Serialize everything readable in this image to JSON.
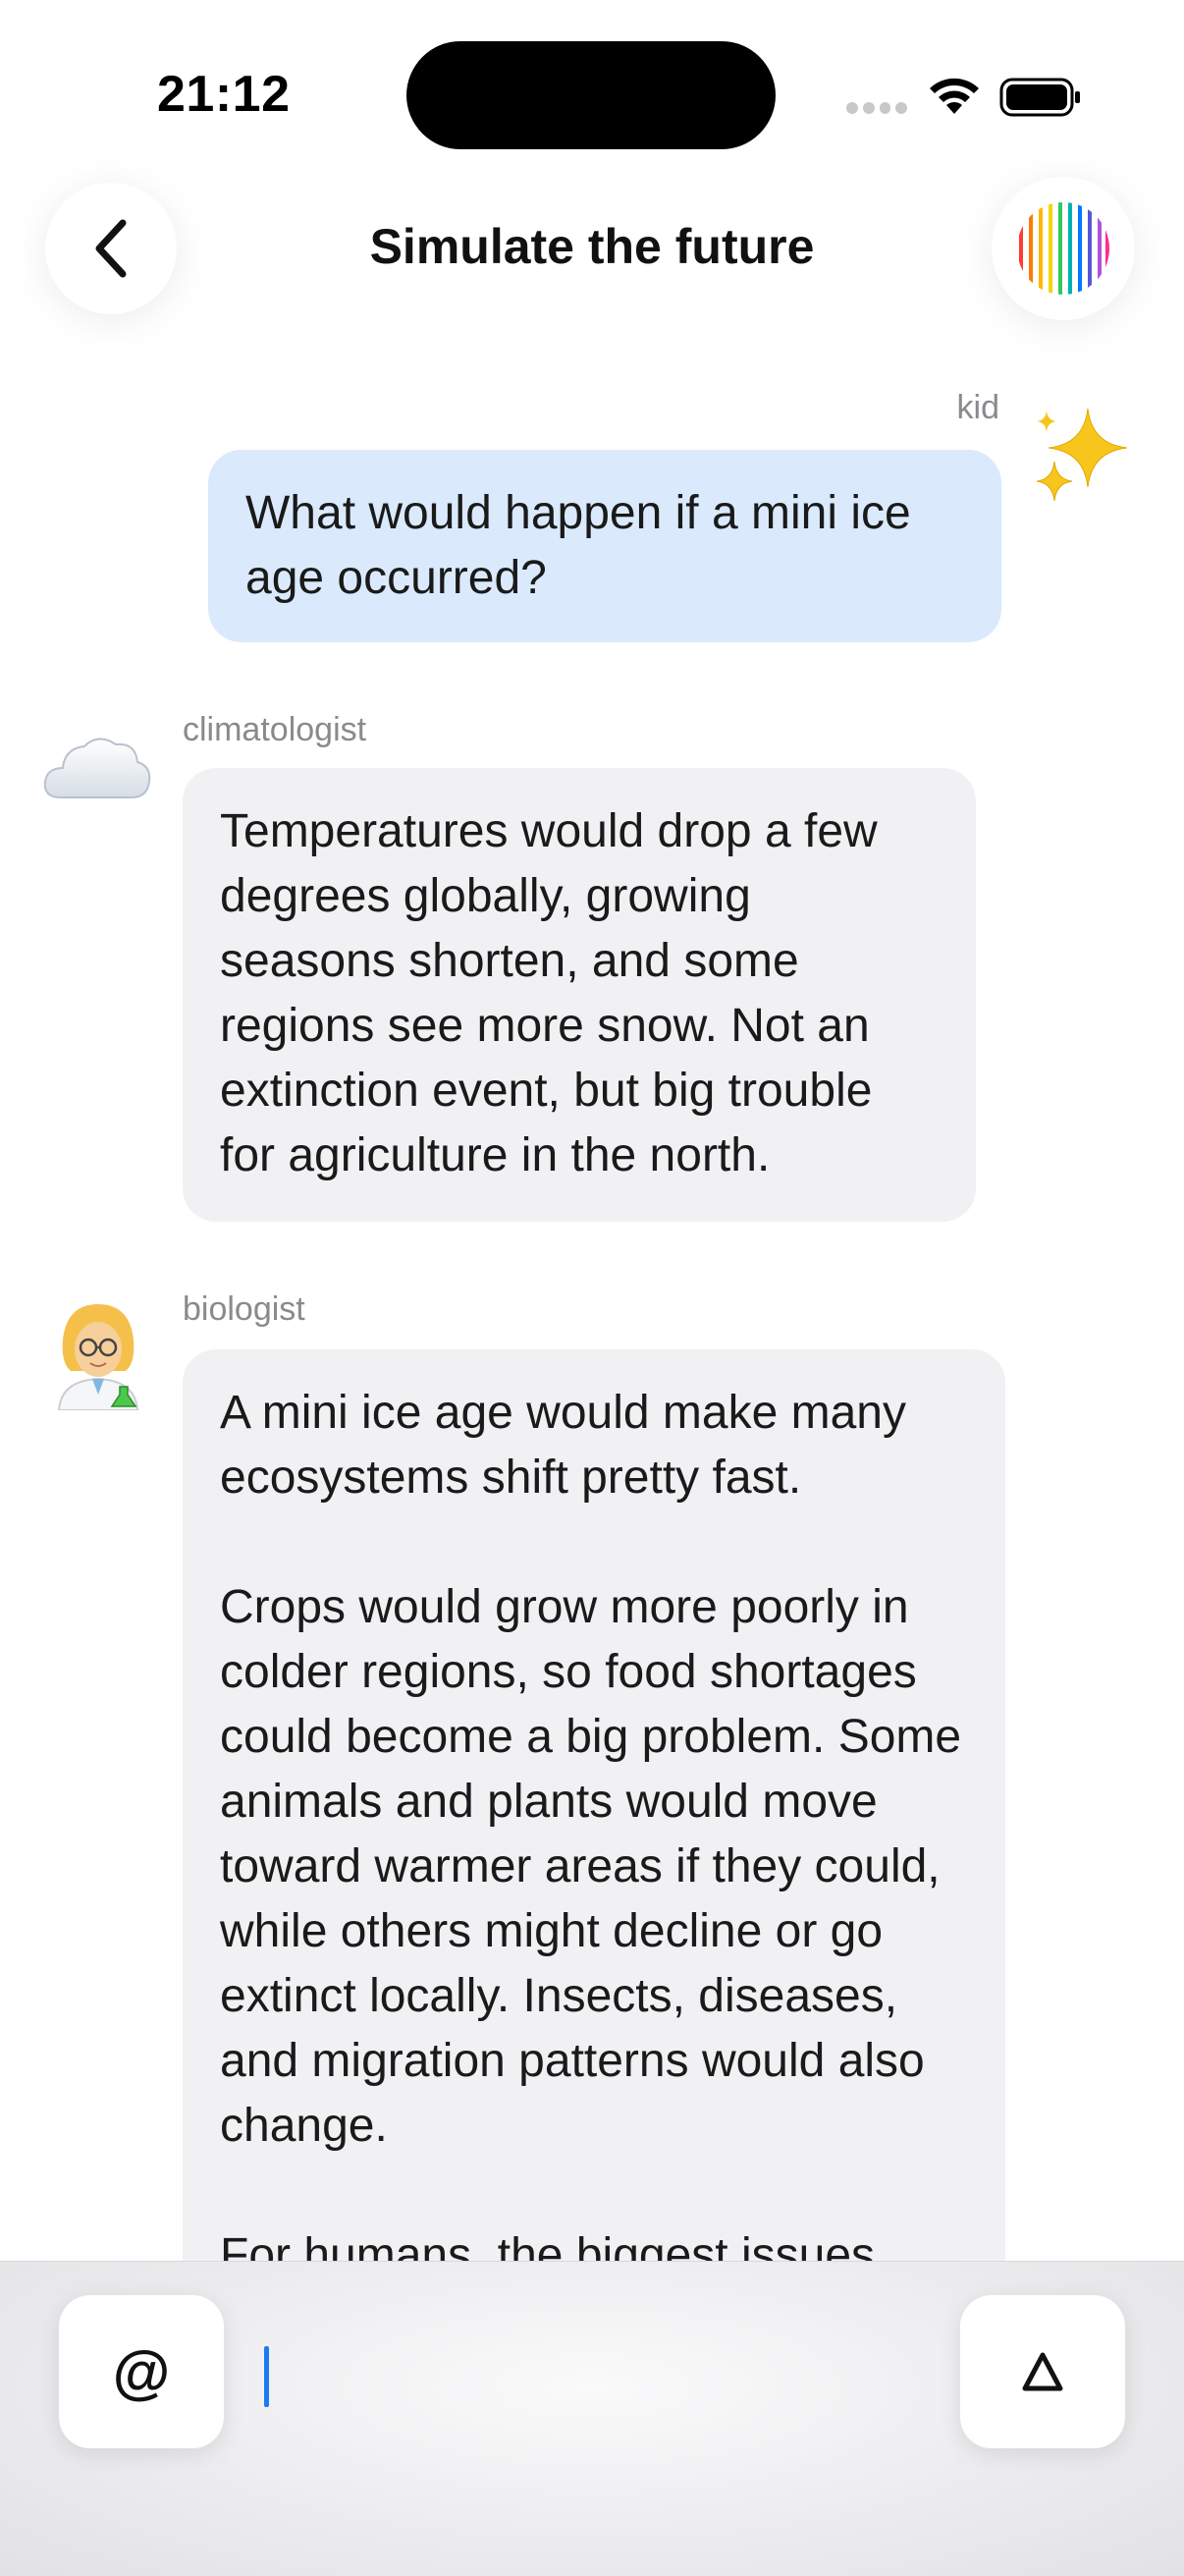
{
  "status_bar": {
    "time": "21:12"
  },
  "header": {
    "title": "Simulate the future"
  },
  "messages": [
    {
      "sender": "kid",
      "text": "What would happen if a mini ice age occurred?",
      "avatar": "sparkles-icon"
    },
    {
      "sender": "climatologist",
      "text": "Temperatures would drop a few degrees globally, growing seasons shorten, and some regions see more snow. Not an extinction event, but big trouble for agriculture in the north.",
      "avatar": "cloud-icon"
    },
    {
      "sender": "biologist",
      "paragraphs": [
        "A mini ice age would make many ecosystems shift pretty fast.",
        "Crops would grow more poorly in colder regions, so food shortages could become a big problem. Some animals and plants would move toward warmer areas if they could, while others might decline or go extinct locally. Insects, diseases, and migration patterns would also change.",
        "For humans, the biggest issues"
      ],
      "avatar": "scientist-icon"
    }
  ],
  "composer": {
    "mention_label": "@",
    "send_label": "∆"
  }
}
